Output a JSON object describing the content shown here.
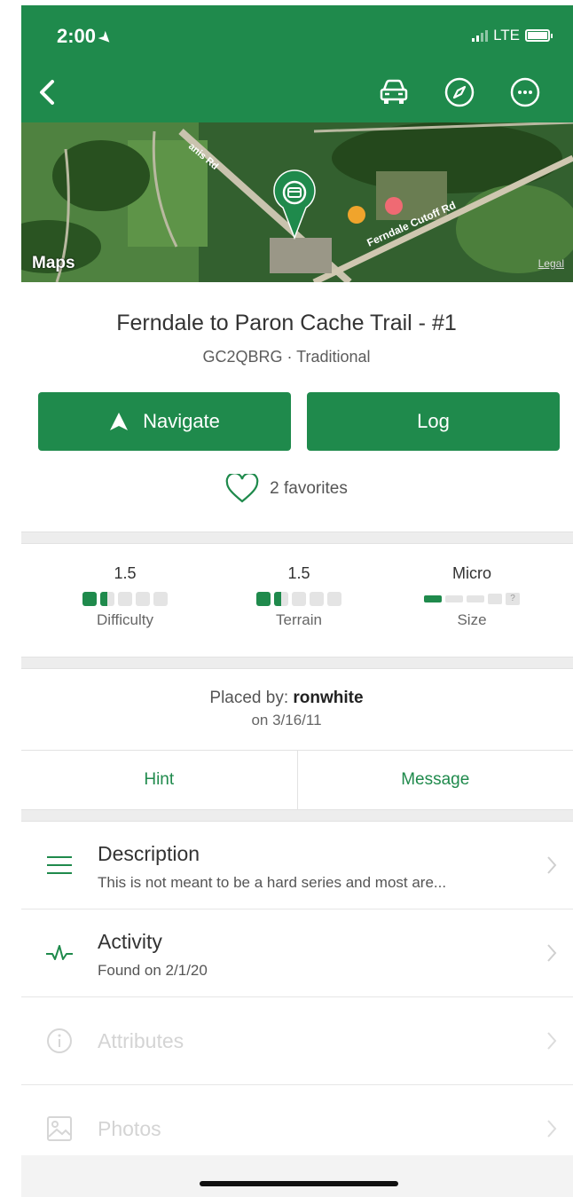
{
  "status_bar": {
    "time": "2:00",
    "network": "LTE"
  },
  "header": {
    "back_icon": "chevron-left-icon",
    "icons": [
      "car-icon",
      "compass-icon",
      "more-icon"
    ],
    "accent_color": "#1f8a4c"
  },
  "map": {
    "road_labels": [
      "Ferndale Cutoff Rd",
      "anis Rd"
    ],
    "attribution": "Maps",
    "legal": "Legal"
  },
  "cache": {
    "title": "Ferndale to Paron Cache Trail - #1",
    "subtitle": "GC2QBRG · Traditional"
  },
  "buttons": {
    "navigate": "Navigate",
    "log": "Log"
  },
  "favorites": "2 favorites",
  "stats": {
    "difficulty": {
      "value": "1.5",
      "label": "Difficulty",
      "rating": 1.5,
      "max": 5
    },
    "terrain": {
      "value": "1.5",
      "label": "Terrain",
      "rating": 1.5,
      "max": 5
    },
    "size": {
      "value": "Micro",
      "label": "Size",
      "level": 1,
      "unknown_symbol": "?"
    }
  },
  "placed": {
    "prefix": "Placed by: ",
    "owner": "ronwhite",
    "date": "on 3/16/11"
  },
  "actions": {
    "hint": "Hint",
    "message": "Message"
  },
  "rows": {
    "description": {
      "title": "Description",
      "subtitle": "This is not meant to be a hard series and most are..."
    },
    "activity": {
      "title": "Activity",
      "subtitle": "Found on 2/1/20"
    },
    "attributes": {
      "title": "Attributes"
    },
    "photos": {
      "title": "Photos"
    }
  }
}
